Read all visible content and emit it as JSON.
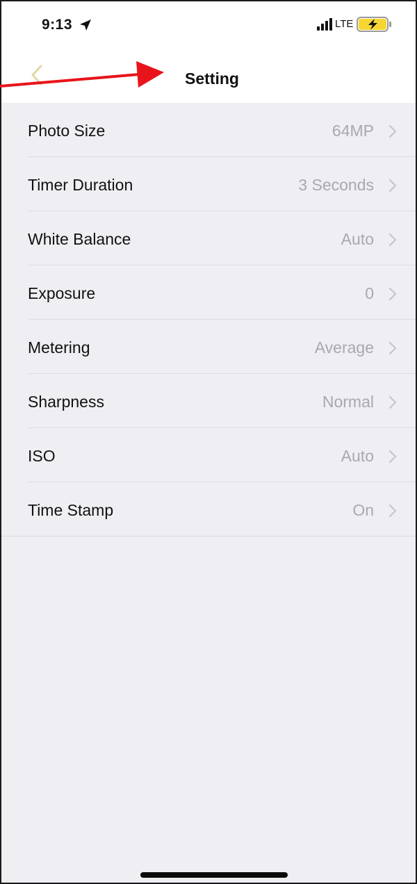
{
  "status_bar": {
    "time": "9:13",
    "network": "LTE",
    "icons": [
      "location-arrow-icon",
      "signal-bars-icon",
      "battery-charging-icon"
    ]
  },
  "nav": {
    "title": "Setting",
    "back_icon": "chevron-left-icon"
  },
  "settings": [
    {
      "label": "Photo Size",
      "value": "64MP"
    },
    {
      "label": "Timer Duration",
      "value": "3 Seconds"
    },
    {
      "label": "White Balance",
      "value": "Auto"
    },
    {
      "label": "Exposure",
      "value": "0"
    },
    {
      "label": "Metering",
      "value": "Average"
    },
    {
      "label": "Sharpness",
      "value": "Normal"
    },
    {
      "label": "ISO",
      "value": "Auto"
    },
    {
      "label": "Time Stamp",
      "value": "On"
    }
  ],
  "colors": {
    "background": "#efeef3",
    "accent_back": "#e3d8a6",
    "annotation": "#e8141b",
    "battery": "#f6d633"
  }
}
